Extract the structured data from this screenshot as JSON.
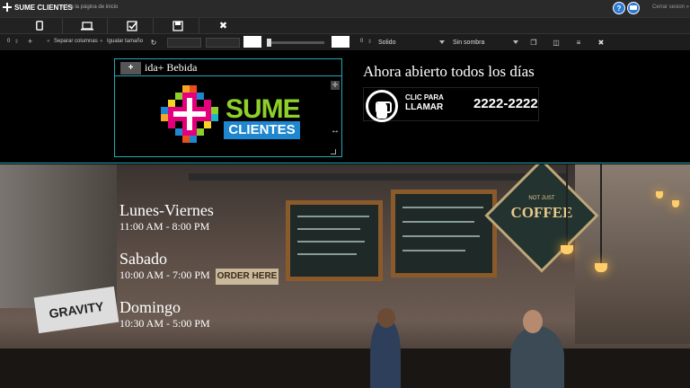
{
  "app": {
    "title": "SUME CLIENTES",
    "back_link": "« Ir a la página de inicio",
    "logout": "Cerrar sesion »",
    "help_icon": "?",
    "chat_icon": "chat-bubble"
  },
  "devices": [
    {
      "name": "mobile",
      "glyph": "▯"
    },
    {
      "name": "desktop",
      "glyph": "▭"
    },
    {
      "name": "checkbox",
      "glyph": "☑"
    },
    {
      "name": "save",
      "glyph": "▣"
    },
    {
      "name": "close",
      "glyph": "✖"
    }
  ],
  "props": {
    "columns_value": "0",
    "add": "+",
    "split_columns": "Separar columnas",
    "equal_size": "Igualar tamaño",
    "refresh": "↻",
    "border_value": "0",
    "border_style": "Solido",
    "shadow": "Sin sombra"
  },
  "page": {
    "block_label": "ida+ Bebida",
    "block_add": "+",
    "brand_sume": "SUME",
    "brand_clientes": "CLIENTES",
    "open_text": "Ahora abierto todos los días",
    "call_line1": "CLIC PARA",
    "call_line2": "LLAMAR",
    "call_number": "2222-2222"
  },
  "hours": [
    {
      "day": "Lunes-Viernes",
      "time": "11:00 AM - 8:00 PM"
    },
    {
      "day": "Sabado",
      "time": "10:00 AM - 7:00 PM"
    },
    {
      "day": "Domingo",
      "time": "10:30 AM - 5:00 PM"
    }
  ],
  "scene": {
    "coffee_sign": "COFFEE",
    "coffee_small": "NOT JUST",
    "gravity": "GRAVITY",
    "order_here": "ORDER HERE"
  },
  "colors": {
    "accent": "#23a9b8",
    "brand_green": "#8ed02b",
    "brand_blue": "#1f87cf"
  }
}
